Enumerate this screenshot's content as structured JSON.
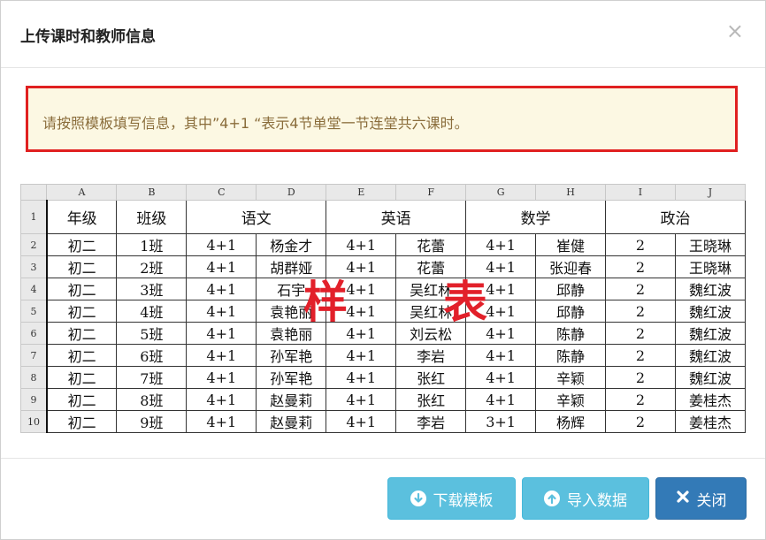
{
  "modal": {
    "title": "上传课时和教师信息",
    "close_glyph": "×"
  },
  "notice": {
    "text": "请按照模板填写信息，其中”4+1 “表示4节单堂一节连堂共六课时。"
  },
  "sample": {
    "stamp_left": "样",
    "stamp_right": "表",
    "column_letters": [
      "A",
      "B",
      "C",
      "D",
      "E",
      "F",
      "G",
      "H",
      "I",
      "J"
    ],
    "header_row": {
      "row_number": "1",
      "grade": "年级",
      "class": "班级",
      "chinese": "语文",
      "english": "英语",
      "math": "数学",
      "politics": "政治"
    },
    "rows": [
      {
        "n": "2",
        "cells": [
          "初二",
          "1班",
          "4+1",
          "杨金才",
          "4+1",
          "花蕾",
          "4+1",
          "崔健",
          "2",
          "王晓琳"
        ]
      },
      {
        "n": "3",
        "cells": [
          "初二",
          "2班",
          "4+1",
          "胡群娅",
          "4+1",
          "花蕾",
          "4+1",
          "张迎春",
          "2",
          "王晓琳"
        ]
      },
      {
        "n": "4",
        "cells": [
          "初二",
          "3班",
          "4+1",
          "石宇",
          "4+1",
          "吴红林",
          "4+1",
          "邱静",
          "2",
          "魏红波"
        ]
      },
      {
        "n": "5",
        "cells": [
          "初二",
          "4班",
          "4+1",
          "袁艳丽",
          "4+1",
          "吴红林",
          "4+1",
          "邱静",
          "2",
          "魏红波"
        ]
      },
      {
        "n": "6",
        "cells": [
          "初二",
          "5班",
          "4+1",
          "袁艳丽",
          "4+1",
          "刘云松",
          "4+1",
          "陈静",
          "2",
          "魏红波"
        ]
      },
      {
        "n": "7",
        "cells": [
          "初二",
          "6班",
          "4+1",
          "孙军艳",
          "4+1",
          "李岩",
          "4+1",
          "陈静",
          "2",
          "魏红波"
        ]
      },
      {
        "n": "8",
        "cells": [
          "初二",
          "7班",
          "4+1",
          "孙军艳",
          "4+1",
          "张红",
          "4+1",
          "辛颖",
          "2",
          "魏红波"
        ]
      },
      {
        "n": "9",
        "cells": [
          "初二",
          "8班",
          "4+1",
          "赵曼莉",
          "4+1",
          "张红",
          "4+1",
          "辛颖",
          "2",
          "姜桂杰"
        ]
      },
      {
        "n": "10",
        "cells": [
          "初二",
          "9班",
          "4+1",
          "赵曼莉",
          "4+1",
          "李岩",
          "3+1",
          "杨辉",
          "2",
          "姜桂杰"
        ]
      }
    ]
  },
  "footer": {
    "download_label": "下载模板",
    "import_label": "导入数据",
    "close_label": "关闭"
  },
  "colors": {
    "info_button": "#5bc0de",
    "primary_button": "#337ab7",
    "notice_border": "#e02020",
    "notice_bg": "#fcf8e3",
    "stamp": "#e2202a"
  },
  "icons": {
    "download": "download-circle-icon",
    "import": "upload-circle-icon",
    "close": "x-mark-icon"
  }
}
